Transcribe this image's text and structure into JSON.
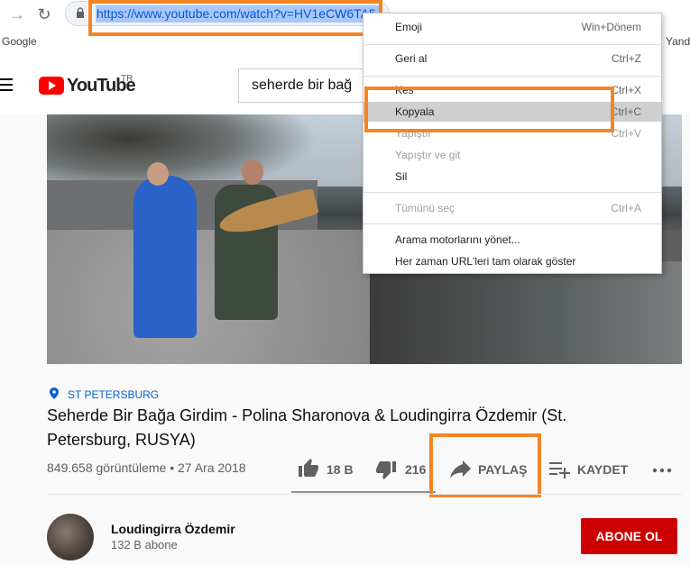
{
  "browser": {
    "url": "https://www.youtube.com/watch?v=HV1eCW6TA5",
    "bookmarks": [
      "Google",
      "Yand"
    ],
    "icons": {
      "forward": "arrow-right-icon",
      "reload": "reload-icon",
      "lock": "lock-icon"
    }
  },
  "youtube": {
    "logo_text": "YouTube",
    "logo_region": "TR",
    "search_query": "seherde bir bağ"
  },
  "context_menu": {
    "items": [
      {
        "label": "Emoji",
        "shortcut": "Win+Dönem",
        "disabled": false
      },
      {
        "label": "Geri al",
        "shortcut": "Ctrl+Z",
        "disabled": false
      },
      {
        "label": "Kes",
        "shortcut": "Ctrl+X",
        "disabled": false
      },
      {
        "label": "Kopyala",
        "shortcut": "Ctrl+C",
        "disabled": false
      },
      {
        "label": "Yapıştır",
        "shortcut": "Ctrl+V",
        "disabled": true
      },
      {
        "label": "Yapıştır ve git",
        "shortcut": "",
        "disabled": true
      },
      {
        "label": "Sil",
        "shortcut": "",
        "disabled": false
      },
      {
        "label": "Tümünü seç",
        "shortcut": "Ctrl+A",
        "disabled": true
      },
      {
        "label": "Arama motorlarını yönet...",
        "shortcut": "",
        "disabled": false
      },
      {
        "label": "Her zaman URL'leri tam olarak göster",
        "shortcut": "",
        "disabled": false
      }
    ],
    "hovered_item": "Kopyala"
  },
  "video": {
    "location": "ST PETERSBURG",
    "title": "Seherde Bir Bağa Girdim - Polina Sharonova & Loudingirra Özdemir (St. Petersburg, RUSYA)",
    "views_date": "849.658 görüntüleme • 27 Ara 2018",
    "likes": "18 B",
    "dislikes": "216",
    "share_label": "PAYLAŞ",
    "save_label": "KAYDET"
  },
  "channel": {
    "name": "Loudingirra Özdemir",
    "subscribers": "132 B abone",
    "subscribe_label": "ABONE OL"
  },
  "colors": {
    "highlight": "#f58425",
    "brand_red": "#ff0000",
    "subscribe_red": "#cc0000",
    "link_blue": "#065fd4"
  }
}
